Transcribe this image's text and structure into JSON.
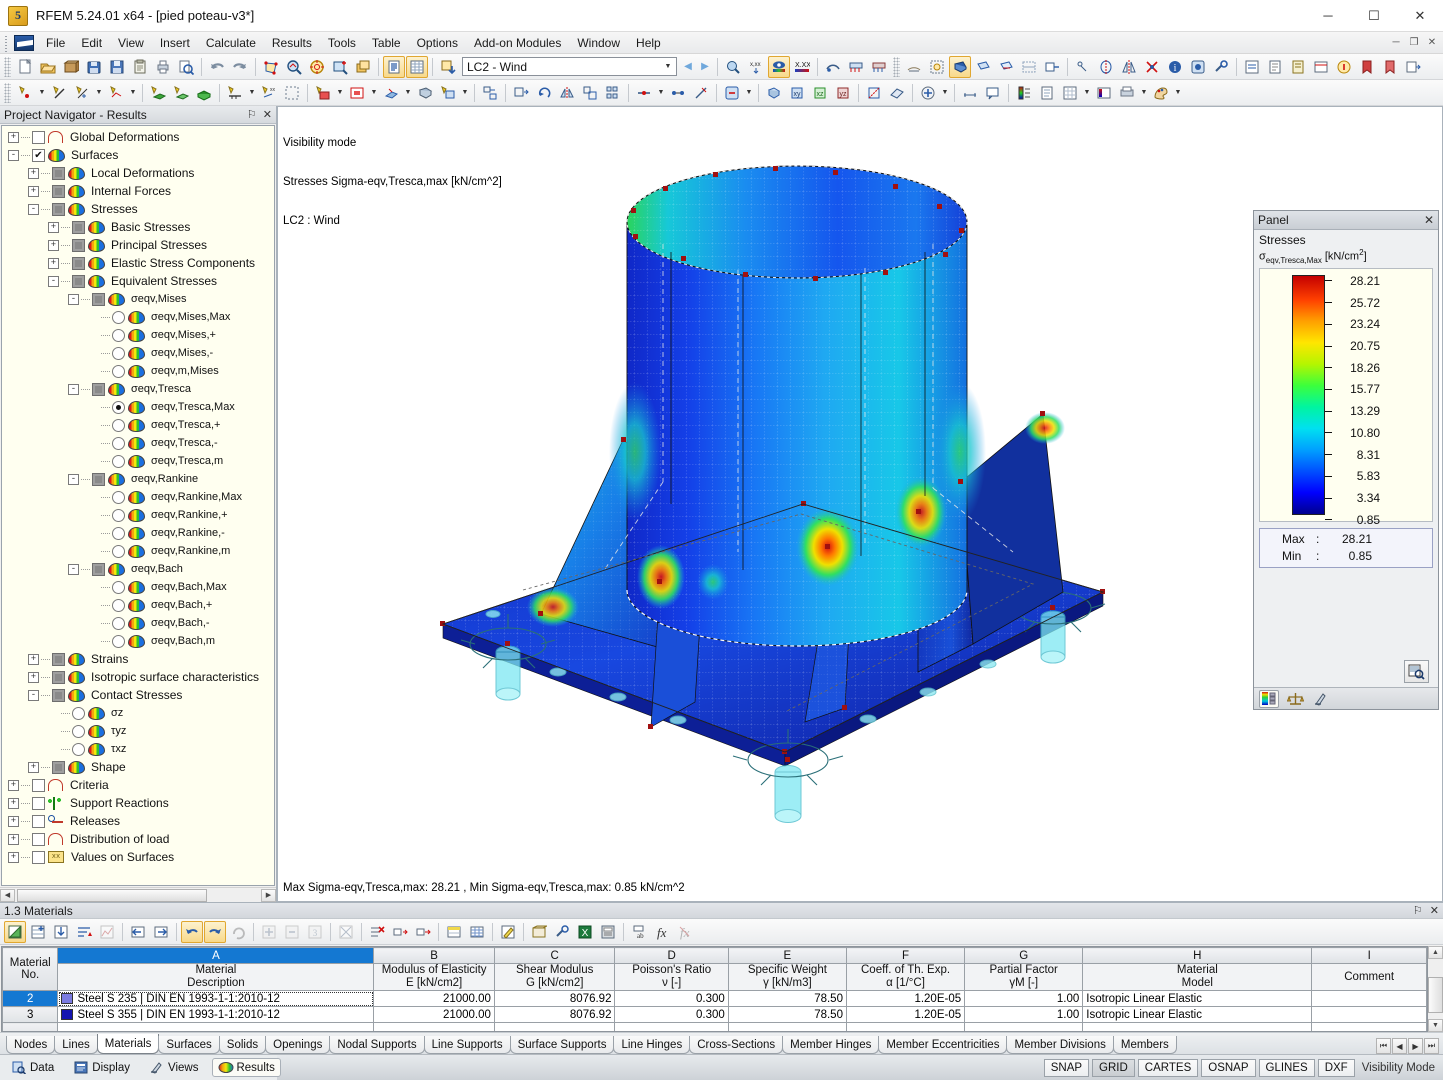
{
  "window": {
    "title": "RFEM 5.24.01 x64 - [pied poteau-v3*]",
    "app_icon": "rfem-logo-icon",
    "minimize": "─",
    "maximize": "☐",
    "close": "✕"
  },
  "menu": {
    "items": [
      {
        "label": "File"
      },
      {
        "label": "Edit"
      },
      {
        "label": "View"
      },
      {
        "label": "Insert"
      },
      {
        "label": "Calculate"
      },
      {
        "label": "Results"
      },
      {
        "label": "Tools"
      },
      {
        "label": "Table"
      },
      {
        "label": "Options"
      },
      {
        "label": "Add-on Modules"
      },
      {
        "label": "Window"
      },
      {
        "label": "Help"
      }
    ],
    "doc_minimize": "─",
    "doc_restore": "❐",
    "doc_close": "✕"
  },
  "toolbar": {
    "load_case": "LC2 - Wind",
    "load_case_arrow": "▼",
    "prev_arrow": "◀",
    "next_arrow": "▶"
  },
  "navigator": {
    "title": "Project Navigator - Results",
    "pin": "⚐",
    "close": "✕",
    "tree": [
      {
        "label": "Global Deformations",
        "depth": 0,
        "exp": "+",
        "ctrl": "checkbox",
        "state": "unchecked",
        "icon": "deformation-icon"
      },
      {
        "label": "Surfaces",
        "depth": 0,
        "exp": "-",
        "ctrl": "checkbox",
        "state": "checked",
        "icon": "surface-icon"
      },
      {
        "label": "Local Deformations",
        "depth": 1,
        "exp": "+",
        "ctrl": "checkbox",
        "state": "gray",
        "icon": "surface-icon"
      },
      {
        "label": "Internal Forces",
        "depth": 1,
        "exp": "+",
        "ctrl": "checkbox",
        "state": "gray",
        "icon": "surface-icon"
      },
      {
        "label": "Stresses",
        "depth": 1,
        "exp": "-",
        "ctrl": "checkbox",
        "state": "gray",
        "icon": "surface-icon"
      },
      {
        "label": "Basic Stresses",
        "depth": 2,
        "exp": "+",
        "ctrl": "checkbox",
        "state": "gray",
        "icon": "surface-icon"
      },
      {
        "label": "Principal Stresses",
        "depth": 2,
        "exp": "+",
        "ctrl": "checkbox",
        "state": "gray",
        "icon": "surface-icon"
      },
      {
        "label": "Elastic Stress Components",
        "depth": 2,
        "exp": "+",
        "ctrl": "checkbox",
        "state": "gray",
        "icon": "surface-icon"
      },
      {
        "label": "Equivalent Stresses",
        "depth": 2,
        "exp": "-",
        "ctrl": "checkbox",
        "state": "gray",
        "icon": "surface-icon"
      },
      {
        "label": "σeqv,Mises",
        "depth": 3,
        "exp": "-",
        "ctrl": "checkbox",
        "state": "gray",
        "icon": "surface-icon",
        "small": true
      },
      {
        "label": "σeqv,Mises,Max",
        "depth": 4,
        "exp": "",
        "ctrl": "radio",
        "state": "off",
        "icon": "surface-icon",
        "small": true
      },
      {
        "label": "σeqv,Mises,+",
        "depth": 4,
        "exp": "",
        "ctrl": "radio",
        "state": "off",
        "icon": "surface-icon",
        "small": true
      },
      {
        "label": "σeqv,Mises,-",
        "depth": 4,
        "exp": "",
        "ctrl": "radio",
        "state": "off",
        "icon": "surface-icon",
        "small": true
      },
      {
        "label": "σeqv,m,Mises",
        "depth": 4,
        "exp": "",
        "ctrl": "radio",
        "state": "off",
        "icon": "surface-icon",
        "small": true
      },
      {
        "label": "σeqv,Tresca",
        "depth": 3,
        "exp": "-",
        "ctrl": "checkbox",
        "state": "gray",
        "icon": "surface-icon",
        "small": true
      },
      {
        "label": "σeqv,Tresca,Max",
        "depth": 4,
        "exp": "",
        "ctrl": "radio",
        "state": "on",
        "icon": "surface-icon",
        "small": true
      },
      {
        "label": "σeqv,Tresca,+",
        "depth": 4,
        "exp": "",
        "ctrl": "radio",
        "state": "off",
        "icon": "surface-icon",
        "small": true
      },
      {
        "label": "σeqv,Tresca,-",
        "depth": 4,
        "exp": "",
        "ctrl": "radio",
        "state": "off",
        "icon": "surface-icon",
        "small": true
      },
      {
        "label": "σeqv,Tresca,m",
        "depth": 4,
        "exp": "",
        "ctrl": "radio",
        "state": "off",
        "icon": "surface-icon",
        "small": true
      },
      {
        "label": "σeqv,Rankine",
        "depth": 3,
        "exp": "-",
        "ctrl": "checkbox",
        "state": "gray",
        "icon": "surface-icon",
        "small": true
      },
      {
        "label": "σeqv,Rankine,Max",
        "depth": 4,
        "exp": "",
        "ctrl": "radio",
        "state": "off",
        "icon": "surface-icon",
        "small": true
      },
      {
        "label": "σeqv,Rankine,+",
        "depth": 4,
        "exp": "",
        "ctrl": "radio",
        "state": "off",
        "icon": "surface-icon",
        "small": true
      },
      {
        "label": "σeqv,Rankine,-",
        "depth": 4,
        "exp": "",
        "ctrl": "radio",
        "state": "off",
        "icon": "surface-icon",
        "small": true
      },
      {
        "label": "σeqv,Rankine,m",
        "depth": 4,
        "exp": "",
        "ctrl": "radio",
        "state": "off",
        "icon": "surface-icon",
        "small": true
      },
      {
        "label": "σeqv,Bach",
        "depth": 3,
        "exp": "-",
        "ctrl": "checkbox",
        "state": "gray",
        "icon": "surface-icon",
        "small": true
      },
      {
        "label": "σeqv,Bach,Max",
        "depth": 4,
        "exp": "",
        "ctrl": "radio",
        "state": "off",
        "icon": "surface-icon",
        "small": true
      },
      {
        "label": "σeqv,Bach,+",
        "depth": 4,
        "exp": "",
        "ctrl": "radio",
        "state": "off",
        "icon": "surface-icon",
        "small": true
      },
      {
        "label": "σeqv,Bach,-",
        "depth": 4,
        "exp": "",
        "ctrl": "radio",
        "state": "off",
        "icon": "surface-icon",
        "small": true
      },
      {
        "label": "σeqv,Bach,m",
        "depth": 4,
        "exp": "",
        "ctrl": "radio",
        "state": "off",
        "icon": "surface-icon",
        "small": true
      },
      {
        "label": "Strains",
        "depth": 1,
        "exp": "+",
        "ctrl": "checkbox",
        "state": "gray",
        "icon": "surface-icon"
      },
      {
        "label": "Isotropic surface characteristics",
        "depth": 1,
        "exp": "+",
        "ctrl": "checkbox",
        "state": "gray",
        "icon": "surface-icon"
      },
      {
        "label": "Contact Stresses",
        "depth": 1,
        "exp": "-",
        "ctrl": "checkbox",
        "state": "gray",
        "icon": "surface-icon"
      },
      {
        "label": "σz",
        "depth": 2,
        "exp": "",
        "ctrl": "radio",
        "state": "off",
        "icon": "surface-icon",
        "small": true
      },
      {
        "label": "τyz",
        "depth": 2,
        "exp": "",
        "ctrl": "radio",
        "state": "off",
        "icon": "surface-icon",
        "small": true
      },
      {
        "label": "τxz",
        "depth": 2,
        "exp": "",
        "ctrl": "radio",
        "state": "off",
        "icon": "surface-icon",
        "small": true
      },
      {
        "label": "Shape",
        "depth": 1,
        "exp": "+",
        "ctrl": "checkbox",
        "state": "gray",
        "icon": "surface-icon"
      },
      {
        "label": "Criteria",
        "depth": 0,
        "exp": "+",
        "ctrl": "checkbox",
        "state": "unchecked",
        "icon": "deformation-icon"
      },
      {
        "label": "Support Reactions",
        "depth": 0,
        "exp": "+",
        "ctrl": "checkbox",
        "state": "unchecked",
        "icon": "support-icon"
      },
      {
        "label": "Releases",
        "depth": 0,
        "exp": "+",
        "ctrl": "checkbox",
        "state": "unchecked",
        "icon": "release-icon"
      },
      {
        "label": "Distribution of load",
        "depth": 0,
        "exp": "+",
        "ctrl": "checkbox",
        "state": "unchecked",
        "icon": "deformation-icon"
      },
      {
        "label": "Values on Surfaces",
        "depth": 0,
        "exp": "+",
        "ctrl": "checkbox",
        "state": "unchecked",
        "icon": "values-icon"
      }
    ],
    "tabs": [
      {
        "label": "Data",
        "icon": "data-icon",
        "selected": false
      },
      {
        "label": "Display",
        "icon": "display-icon",
        "selected": false
      },
      {
        "label": "Views",
        "icon": "views-icon",
        "selected": false
      },
      {
        "label": "Results",
        "icon": "results-icon",
        "selected": true
      }
    ]
  },
  "viewport": {
    "top_lines": [
      "Visibility mode",
      "Stresses Sigma-eqv,Tresca,max [kN/cm^2]",
      "LC2 : Wind"
    ],
    "bottom_line": "Max Sigma-eqv,Tresca,max: 28.21 , Min Sigma-eqv,Tresca,max: 0.85 kN/cm^2"
  },
  "panel": {
    "title": "Panel",
    "close": "✕",
    "heading": "Stresses",
    "quantity_prefix": "σ",
    "quantity_sub": "eqv,Tresca,Max",
    "unit_base": "[kN/cm",
    "unit_sup": "2",
    "unit_close": "]",
    "max_label": "Max",
    "min_label": "Min",
    "colon": ":",
    "max_value": "28.21",
    "min_value": "0.85",
    "zoom_icon": "magnify-table-icon",
    "tabs": [
      {
        "icon": "color-scale-icon",
        "selected": true
      },
      {
        "icon": "factors-icon",
        "selected": false
      },
      {
        "icon": "viewpoint-icon",
        "selected": false
      }
    ]
  },
  "chart_data": {
    "type": "heatmap",
    "title": "Stresses σeqv,Tresca,Max [kN/cm²]",
    "unit": "kN/cm^2",
    "legend_position": "right",
    "scale_labels": [
      "28.21",
      "25.72",
      "23.24",
      "20.75",
      "18.26",
      "15.77",
      "13.29",
      "10.80",
      "8.31",
      "5.83",
      "3.34",
      "0.85"
    ],
    "scale_values": [
      28.21,
      25.72,
      23.24,
      20.75,
      18.26,
      15.77,
      13.29,
      10.8,
      8.31,
      5.83,
      3.34,
      0.85
    ],
    "scale_colors": [
      "#c40000",
      "#ff2000",
      "#ff6000",
      "#ffa000",
      "#ffe600",
      "#c8f000",
      "#3cff3c",
      "#00f5a0",
      "#00e0f0",
      "#00a0ff",
      "#0030ff",
      "#00008f"
    ],
    "max": 28.21,
    "min": 0.85,
    "load_case": "LC2 - Wind"
  },
  "table": {
    "caption": "1.3 Materials",
    "pin": "⚐",
    "close": "✕",
    "columns": [
      {
        "letter": "A",
        "name": "Material",
        "unit": "Description",
        "selected": true
      },
      {
        "letter": "B",
        "name": "Modulus of Elasticity",
        "unit": "E [kN/cm2]",
        "selected": false
      },
      {
        "letter": "C",
        "name": "Shear Modulus",
        "unit": "G [kN/cm2]",
        "selected": false
      },
      {
        "letter": "D",
        "name": "Poisson's Ratio",
        "unit": "ν [-]",
        "selected": false
      },
      {
        "letter": "E",
        "name": "Specific Weight",
        "unit": "γ [kN/m3]",
        "selected": false
      },
      {
        "letter": "F",
        "name": "Coeff. of Th. Exp.",
        "unit": "α [1/°C]",
        "selected": false
      },
      {
        "letter": "G",
        "name": "Partial Factor",
        "unit": "γM [-]",
        "selected": false
      },
      {
        "letter": "H",
        "name": "Material",
        "unit": "Model",
        "selected": false
      },
      {
        "letter": "I",
        "name": "",
        "unit": "Comment",
        "selected": false
      }
    ],
    "rowno_header1": "Material",
    "rowno_header2": "No.",
    "rows": [
      {
        "no": "2",
        "selected": true,
        "swatch": "#7b7be0",
        "description": "Steel S 235 | DIN EN 1993-1-1:2010-12",
        "E": "21000.00",
        "G": "8076.92",
        "nu": "0.300",
        "gamma": "78.50",
        "alpha": "1.20E-05",
        "gammaM": "1.00",
        "model": "Isotropic Linear Elastic",
        "comment": ""
      },
      {
        "no": "3",
        "selected": false,
        "swatch": "#1515b0",
        "description": "Steel S 355 | DIN EN 1993-1-1:2010-12",
        "E": "21000.00",
        "G": "8076.92",
        "nu": "0.300",
        "gamma": "78.50",
        "alpha": "1.20E-05",
        "gammaM": "1.00",
        "model": "Isotropic Linear Elastic",
        "comment": ""
      }
    ],
    "tabs": [
      {
        "label": "Nodes",
        "selected": false
      },
      {
        "label": "Lines",
        "selected": false
      },
      {
        "label": "Materials",
        "selected": true
      },
      {
        "label": "Surfaces",
        "selected": false
      },
      {
        "label": "Solids",
        "selected": false
      },
      {
        "label": "Openings",
        "selected": false
      },
      {
        "label": "Nodal Supports",
        "selected": false
      },
      {
        "label": "Line Supports",
        "selected": false
      },
      {
        "label": "Surface Supports",
        "selected": false
      },
      {
        "label": "Line Hinges",
        "selected": false
      },
      {
        "label": "Cross-Sections",
        "selected": false
      },
      {
        "label": "Member Hinges",
        "selected": false
      },
      {
        "label": "Member Eccentricities",
        "selected": false
      },
      {
        "label": "Member Divisions",
        "selected": false
      },
      {
        "label": "Members",
        "selected": false
      }
    ],
    "nav_buttons": [
      "⏮",
      "◀",
      "▶",
      "⏭"
    ]
  },
  "statusbar": {
    "toggles": [
      {
        "label": "SNAP",
        "on": false
      },
      {
        "label": "GRID",
        "on": true
      },
      {
        "label": "CARTES",
        "on": false
      },
      {
        "label": "OSNAP",
        "on": false
      },
      {
        "label": "GLINES",
        "on": false
      },
      {
        "label": "DXF",
        "on": false
      }
    ],
    "mode": "Visibility Mode"
  }
}
